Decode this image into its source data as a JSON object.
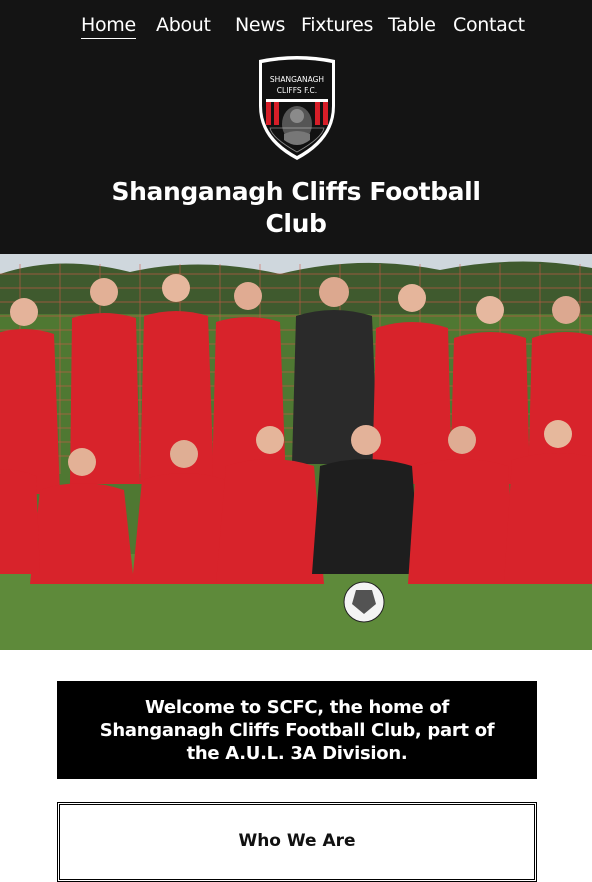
{
  "nav": {
    "items": [
      {
        "label": "Home",
        "active": true
      },
      {
        "label": "About",
        "active": false
      },
      {
        "label": "News",
        "active": false
      },
      {
        "label": "Fixtures",
        "active": false
      },
      {
        "label": "Table",
        "active": false
      },
      {
        "label": "Contact",
        "active": false
      }
    ]
  },
  "crest": {
    "line1": "SHANGANAGH",
    "line2": "CLIFFS F.C.",
    "colors": {
      "red": "#d71e28",
      "black": "#111111",
      "white": "#ffffff"
    }
  },
  "header": {
    "title": "Shanganagh Cliffs Football Club"
  },
  "hero": {
    "icon": "team-photo"
  },
  "welcome": {
    "text": "Welcome to SCFC, the home of Shanganagh Cliffs Football Club, part of the A.U.L. 3A Division."
  },
  "who": {
    "title": "Who We Are"
  },
  "colors": {
    "header_bg": "#141414",
    "kit_red": "#d8232b",
    "keeper": "#2a2a2a",
    "pitch": "#5e8a3a"
  }
}
